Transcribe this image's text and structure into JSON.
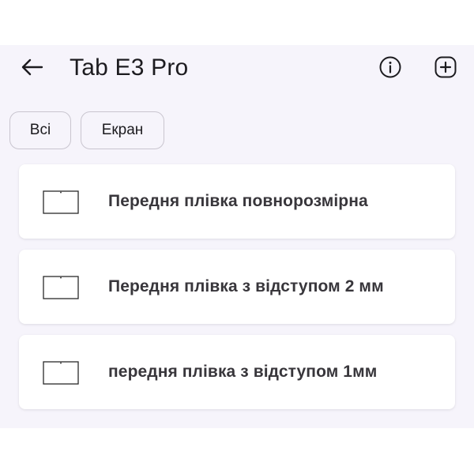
{
  "header": {
    "title": "Tab E3 Pro",
    "back_icon": "arrow-left-icon",
    "info_icon": "info-circle-icon",
    "add_icon": "plus-square-icon"
  },
  "filters": {
    "chips": [
      {
        "label": "Всі"
      },
      {
        "label": "Екран"
      }
    ]
  },
  "items": [
    {
      "label": "Передня плівка повнорозмірна",
      "icon": "screen-protector-icon"
    },
    {
      "label": "Передня плівка з відступом 2 мм",
      "icon": "screen-protector-icon"
    },
    {
      "label": "передня плівка з відступом 1мм",
      "icon": "screen-protector-icon"
    }
  ],
  "colors": {
    "background": "#f6f4fb",
    "card": "#ffffff",
    "text": "#1c1b1f",
    "chip_border": "#c9c5cf"
  }
}
